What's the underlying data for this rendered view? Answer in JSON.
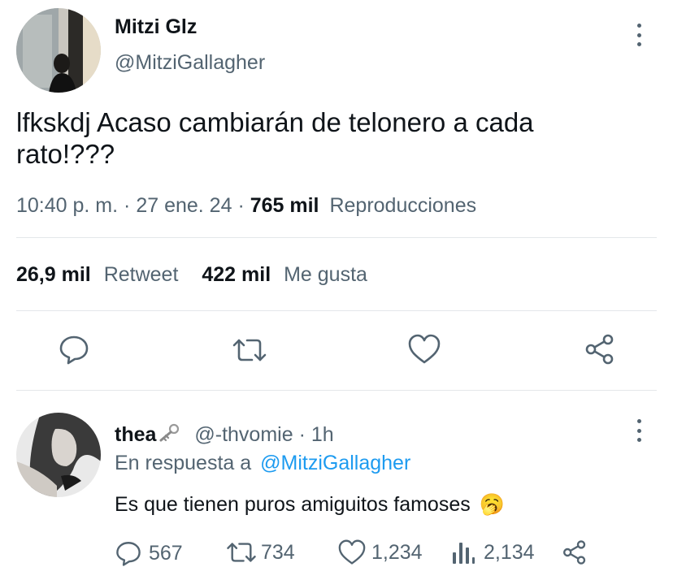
{
  "tweet": {
    "author_name": "Mitzi Glz",
    "author_handle": "@MitziGallagher",
    "text_line1": "lfkskdj Acaso cambiarán de telonero a cada",
    "text_line2": "rato!???",
    "time": "10:40 p. m.",
    "sep1": "·",
    "date": "27 ene. 24",
    "sep2": "·",
    "views_count": "765 mil",
    "views_label": "Reproducciones",
    "retweets_count": "26,9 mil",
    "retweets_label": "Retweet",
    "likes_count": "422 mil",
    "likes_label": "Me gusta",
    "actions": [
      "reply-icon",
      "retweet-icon",
      "like-icon",
      "share-icon"
    ]
  },
  "reply": {
    "author_name": "thea",
    "handle": "@-thvomie",
    "sep": "·",
    "time_ago": "1h",
    "replying_prefix": "En respuesta a",
    "replying_to": "@MitziGallagher",
    "text": "Es que tienen puros amiguitos famoses",
    "emoji": "🥱",
    "stats": {
      "replies": "567",
      "retweets": "734",
      "likes": "1,234",
      "views": "2,134"
    }
  },
  "colors": {
    "text_primary": "#0f1419",
    "text_secondary": "#536471",
    "link": "#1d9bf0",
    "divider": "#e4e7ea"
  }
}
